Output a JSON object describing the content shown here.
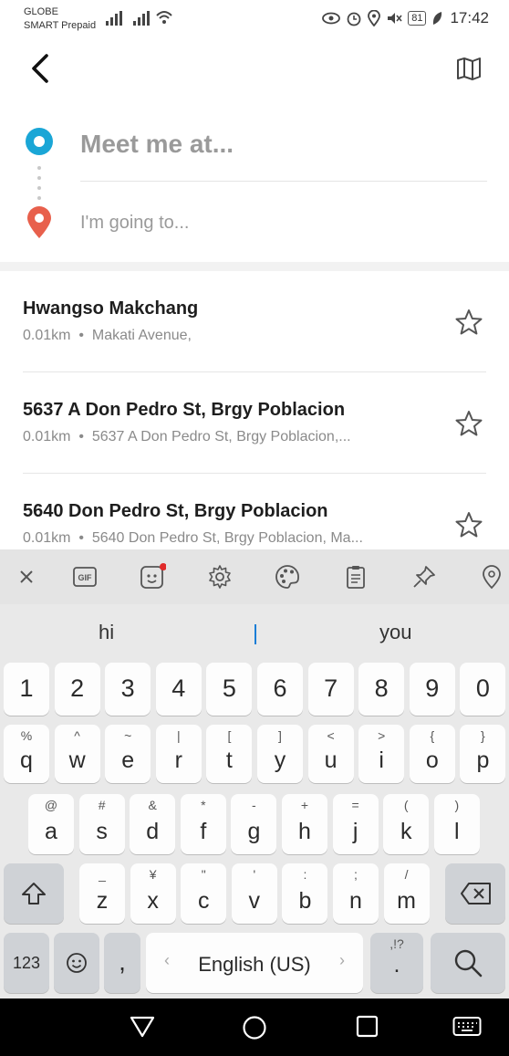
{
  "status_bar": {
    "carrier_line1": "GLOBE",
    "carrier_line2": "SMART Prepaid",
    "battery": "81",
    "time": "17:42"
  },
  "header": {
    "back_icon": "back-arrow-icon",
    "map_icon": "map-icon"
  },
  "route": {
    "pickup_placeholder": "Meet me at...",
    "dropoff_placeholder": "I'm going to...",
    "pickup_color": "#1aa6d6",
    "dropoff_color": "#e8604c"
  },
  "results": [
    {
      "title": "Hwangso Makchang",
      "distance": "0.01km",
      "address": "Makati Avenue,"
    },
    {
      "title": "5637 A Don Pedro St, Brgy Poblacion",
      "distance": "0.01km",
      "address": "5637 A Don Pedro St, Brgy Poblacion,..."
    },
    {
      "title": "5640 Don Pedro St, Brgy Poblacion",
      "distance": "0.01km",
      "address": "5640 Don Pedro St, Brgy Poblacion, Ma..."
    }
  ],
  "keyboard": {
    "toolbar_icons": [
      "close-icon",
      "gif-icon",
      "sticker-icon",
      "settings-icon",
      "theme-icon",
      "clipboard-icon",
      "pin-icon",
      "location-icon"
    ],
    "suggestions": [
      "hi",
      "you"
    ],
    "number_row": [
      "1",
      "2",
      "3",
      "4",
      "5",
      "6",
      "7",
      "8",
      "9",
      "0"
    ],
    "row1": [
      {
        "k": "q",
        "a": "%"
      },
      {
        "k": "w",
        "a": "^"
      },
      {
        "k": "e",
        "a": "~"
      },
      {
        "k": "r",
        "a": "|"
      },
      {
        "k": "t",
        "a": "["
      },
      {
        "k": "y",
        "a": "]"
      },
      {
        "k": "u",
        "a": "<"
      },
      {
        "k": "i",
        "a": ">"
      },
      {
        "k": "o",
        "a": "{"
      },
      {
        "k": "p",
        "a": "}"
      }
    ],
    "row2": [
      {
        "k": "a",
        "a": "@"
      },
      {
        "k": "s",
        "a": "#"
      },
      {
        "k": "d",
        "a": "&"
      },
      {
        "k": "f",
        "a": "*"
      },
      {
        "k": "g",
        "a": "-"
      },
      {
        "k": "h",
        "a": "+"
      },
      {
        "k": "j",
        "a": "="
      },
      {
        "k": "k",
        "a": "("
      },
      {
        "k": "l",
        "a": ")"
      }
    ],
    "row3": [
      {
        "k": "z",
        "a": "_"
      },
      {
        "k": "x",
        "a": "¥"
      },
      {
        "k": "c",
        "a": "\""
      },
      {
        "k": "v",
        "a": "'"
      },
      {
        "k": "b",
        "a": ":"
      },
      {
        "k": "n",
        "a": ";"
      },
      {
        "k": "m",
        "a": "/"
      }
    ],
    "symbols_label": "123",
    "comma": ",",
    "space_label": "English (US)",
    "period": ".",
    "period_alt": ",!?"
  }
}
